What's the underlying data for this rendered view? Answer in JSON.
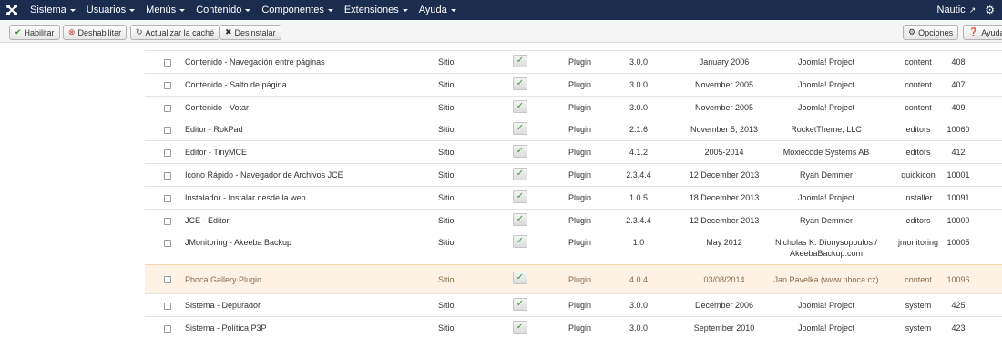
{
  "navbar": {
    "menu": [
      "Sistema",
      "Usuarios",
      "Menús",
      "Contenido",
      "Componentes",
      "Extensiones",
      "Ayuda"
    ],
    "site_name": "Nautic"
  },
  "toolbar": {
    "enable": "Habilitar",
    "disable": "Deshabilitar",
    "refresh_cache": "Actualizar la caché",
    "uninstall": "Desinstalar",
    "options": "Opciones",
    "help": "Ayuda"
  },
  "rows": [
    {
      "name": "Contenido - Navegación entre páginas",
      "location": "Sitio",
      "type": "Plugin",
      "version": "3.0.0",
      "date": "January 2006",
      "author": "Joomla! Project",
      "folder": "content",
      "id": "408"
    },
    {
      "name": "Contenido - Salto de página",
      "location": "Sitio",
      "type": "Plugin",
      "version": "3.0.0",
      "date": "November 2005",
      "author": "Joomla! Project",
      "folder": "content",
      "id": "407"
    },
    {
      "name": "Contenido - Votar",
      "location": "Sitio",
      "type": "Plugin",
      "version": "3.0.0",
      "date": "November 2005",
      "author": "Joomla! Project",
      "folder": "content",
      "id": "409"
    },
    {
      "name": "Editor - RokPad",
      "location": "Sitio",
      "type": "Plugin",
      "version": "2.1.6",
      "date": "November 5, 2013",
      "author": "RocketTheme, LLC",
      "folder": "editors",
      "id": "10060"
    },
    {
      "name": "Editor - TinyMCE",
      "location": "Sitio",
      "type": "Plugin",
      "version": "4.1.2",
      "date": "2005-2014",
      "author": "Moxiecode Systems AB",
      "folder": "editors",
      "id": "412"
    },
    {
      "name": "Icono Rápido - Navegador de Archivos JCE",
      "location": "Sitio",
      "type": "Plugin",
      "version": "2.3.4.4",
      "date": "12 December 2013",
      "author": "Ryan Demmer",
      "folder": "quickicon",
      "id": "10001"
    },
    {
      "name": "Instalador - Instalar desde la web",
      "location": "Sitio",
      "type": "Plugin",
      "version": "1.0.5",
      "date": "18 December 2013",
      "author": "Joomla! Project",
      "folder": "installer",
      "id": "10091"
    },
    {
      "name": "JCE - Editor",
      "location": "Sitio",
      "type": "Plugin",
      "version": "2.3.4.4",
      "date": "12 December 2013",
      "author": "Ryan Demmer",
      "folder": "editors",
      "id": "10000"
    },
    {
      "name": "JMonitoring - Akeeba Backup",
      "location": "Sitio",
      "type": "Plugin",
      "version": "1.0",
      "date": "May 2012",
      "author": "Nicholas K. Dionysopoulos / AkeebaBackup.com",
      "folder": "jmonitoring",
      "id": "10005"
    },
    {
      "name": "Phoca Gallery Plugin",
      "location": "Sitio",
      "type": "Plugin",
      "version": "4.0.4",
      "date": "03/08/2014",
      "author": "Jan Pavelka (www.phoca.cz)",
      "folder": "content",
      "id": "10096"
    },
    {
      "name": "Sistema - Depurador",
      "location": "Sitio",
      "type": "Plugin",
      "version": "3.0.0",
      "date": "December 2006",
      "author": "Joomla! Project",
      "folder": "system",
      "id": "425"
    },
    {
      "name": "Sistema - Política P3P",
      "location": "Sitio",
      "type": "Plugin",
      "version": "3.0.0",
      "date": "September 2010",
      "author": "Joomla! Project",
      "folder": "system",
      "id": "423"
    }
  ]
}
